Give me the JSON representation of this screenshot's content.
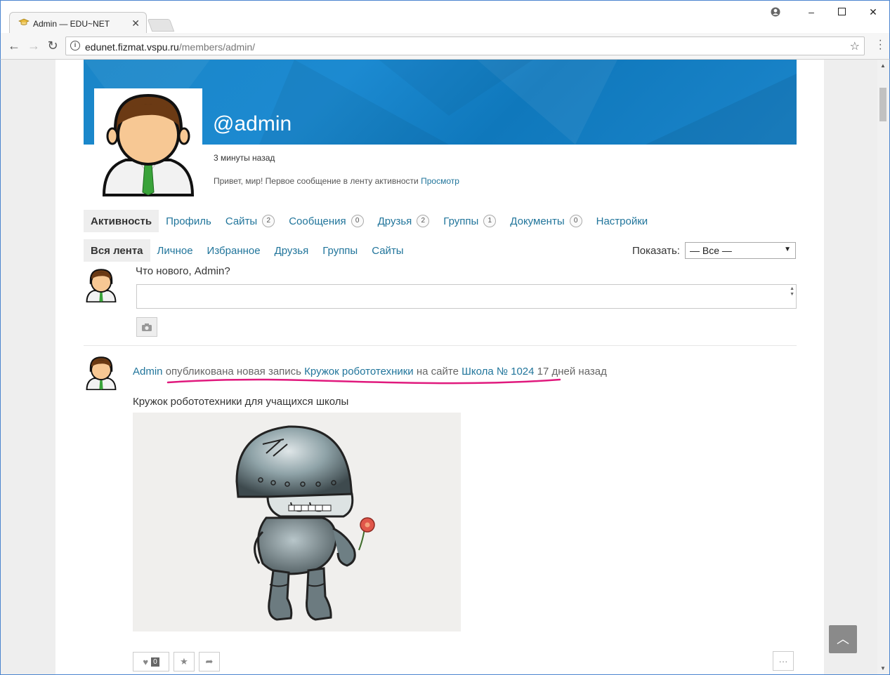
{
  "browser": {
    "tab_title": "Admin — EDU~NET",
    "url_host": "edunet.fizmat.vspu.ru",
    "url_path": "/members/admin/"
  },
  "profile": {
    "username": "@admin",
    "last_active": "3 минуты назад",
    "latest_update": "Привет, мир! Первое сообщение в ленту активности",
    "latest_update_link": "Просмотр"
  },
  "primary_nav": [
    {
      "label": "Активность",
      "count": null,
      "active": true
    },
    {
      "label": "Профиль",
      "count": null,
      "active": false
    },
    {
      "label": "Сайты",
      "count": "2",
      "active": false
    },
    {
      "label": "Сообщения",
      "count": "0",
      "active": false
    },
    {
      "label": "Друзья",
      "count": "2",
      "active": false
    },
    {
      "label": "Группы",
      "count": "1",
      "active": false
    },
    {
      "label": "Документы",
      "count": "0",
      "active": false
    },
    {
      "label": "Настройки",
      "count": null,
      "active": false
    }
  ],
  "sub_nav": [
    {
      "label": "Вся лента",
      "active": true
    },
    {
      "label": "Личное",
      "active": false
    },
    {
      "label": "Избранное",
      "active": false
    },
    {
      "label": "Друзья",
      "active": false
    },
    {
      "label": "Группы",
      "active": false
    },
    {
      "label": "Сайты",
      "active": false
    }
  ],
  "filter": {
    "label": "Показать:",
    "selected": "— Все —"
  },
  "post_form": {
    "prompt": "Что нового, Admin?"
  },
  "activity": {
    "user": "Admin",
    "action": "опубликована новая запись",
    "post_title": "Кружок робототехники",
    "on_site": "на сайте",
    "site_name": "Школа № 1024",
    "time": "17 дней назад",
    "excerpt": "Кружок робототехники для учащихся школы",
    "favorite_count": "0"
  },
  "colors": {
    "link": "#21759b",
    "cover": "#1a86c8",
    "annotation": "#e0197d"
  }
}
